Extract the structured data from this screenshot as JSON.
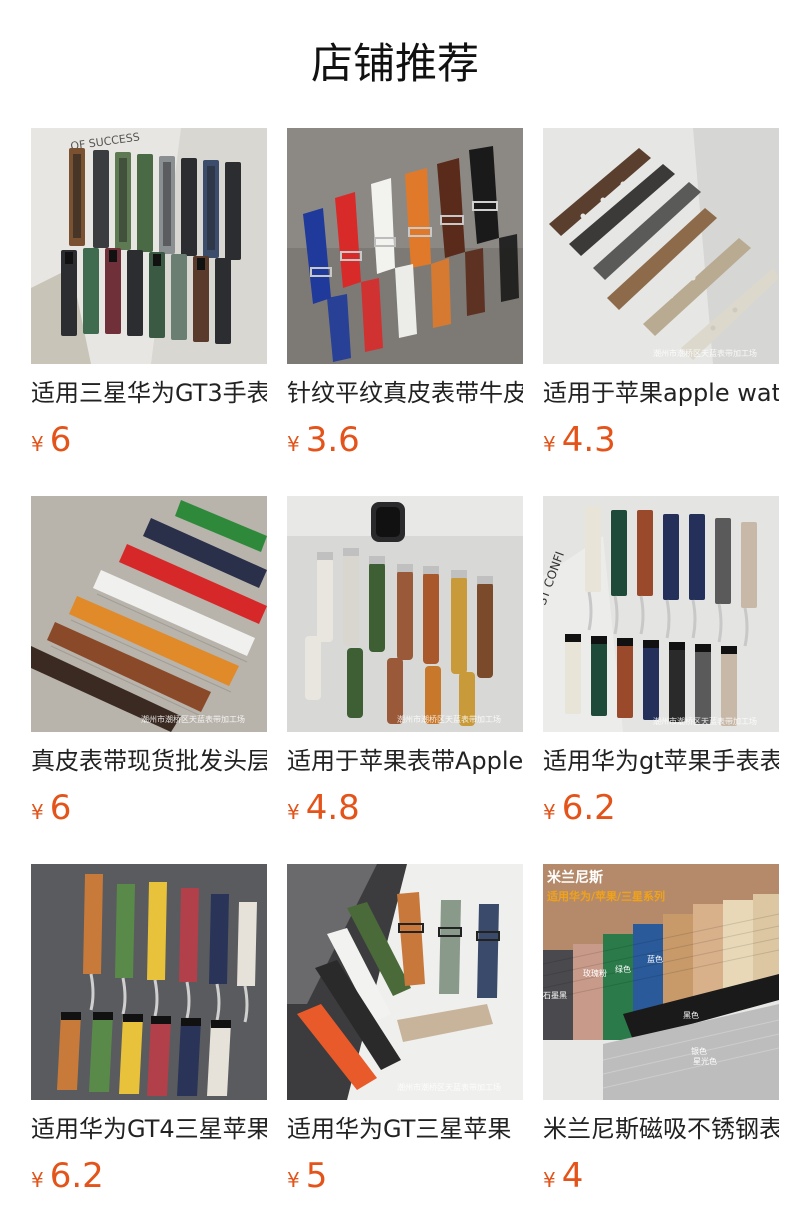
{
  "page": {
    "title": "店铺推荐",
    "currency_symbol": "¥"
  },
  "colors": {
    "price": "#e4531a",
    "title_text": "#222222"
  },
  "products": [
    {
      "title": "适用三星华为GT3手表",
      "price": "6",
      "image": {
        "scene": "bands-rubber-leather-grid",
        "background": "#d9d7d2",
        "accent_text": "OF SUCCESS",
        "strap_colors": [
          "#7a5232",
          "#3a3c3f",
          "#5d7a52",
          "#4a6a45",
          "#8a8f92",
          "#3b4d6b",
          "#2b2d30",
          "#6b2f2a",
          "#3f6b4e",
          "#70303a",
          "#5a3a2a",
          "#6a7e72"
        ]
      }
    },
    {
      "title": "针纹平纹真皮表带牛皮",
      "price": "3.6",
      "image": {
        "scene": "bands-leather-row",
        "background": "#7d7a76",
        "strap_colors": [
          "#1f3a9a",
          "#d92a2a",
          "#f2f2ef",
          "#e07a2a",
          "#5a2a1a",
          "#1a1a1a"
        ]
      }
    },
    {
      "title": "适用于苹果apple watch",
      "price": "4.3",
      "image": {
        "scene": "bands-loop-diagonal",
        "background": "#e6e6e4",
        "watermark": "潮州市潮桥区天蓝表带加工场",
        "strap_colors": [
          "#5a3e2e",
          "#3c3a38",
          "#5a5a58",
          "#8c6a4a",
          "#b8ab92",
          "#dcd8cc"
        ]
      }
    },
    {
      "title": "真皮表带现货批发头层",
      "price": "6",
      "image": {
        "scene": "bands-croc-diagonal",
        "background": "#b8b3ab",
        "watermark": "潮州市潮桥区天蓝表带加工场",
        "strap_colors": [
          "#2e8a3a",
          "#2a2f4a",
          "#d62828",
          "#f0f0ee",
          "#e08a2a",
          "#8a4a2a",
          "#3a2a22"
        ]
      }
    },
    {
      "title": "适用于苹果表带Apple",
      "price": "4.8",
      "image": {
        "scene": "bands-apple-leather",
        "background": "#d8d8d6",
        "watermark": "潮州市潮桥区天蓝表带加工场",
        "strap_colors": [
          "#e8e6df",
          "#d8d6cf",
          "#3e5e34",
          "#9a5a3a",
          "#c8782a",
          "#c89a3a",
          "#7a4a2a"
        ]
      }
    },
    {
      "title": "适用华为gt苹果手表表带",
      "price": "6.2",
      "image": {
        "scene": "bands-butterfly-clasp",
        "background": "#e4e4e2",
        "accent_text": "ST CONFI",
        "watermark": "潮州市潮桥区天蓝表带加工场",
        "strap_colors": [
          "#e8e4d8",
          "#1e4a3a",
          "#9a4a2a",
          "#24305a",
          "#5a5a5a",
          "#2a2a2a",
          "#c8b8a8"
        ]
      }
    },
    {
      "title": "适用华为GT4三星苹果",
      "price": "6.2",
      "image": {
        "scene": "bands-butterfly-colors",
        "background": "#5a5b5e",
        "strap_colors": [
          "#c87a3a",
          "#5a8a4a",
          "#e8c23a",
          "#b2404a",
          "#2a3458",
          "#e6e2da"
        ]
      }
    },
    {
      "title": "适用华为GT三星苹果",
      "price": "5",
      "image": {
        "scene": "bands-canvas-mix",
        "background": "#efefed",
        "watermark": "潮州市潮桥区天蓝表带加工场",
        "strap_colors": [
          "#f2f2f0",
          "#2a2a2a",
          "#e85a2a",
          "#4a6a3a",
          "#c8783a",
          "#8a9a8a",
          "#3a4a6a",
          "#c8b49a"
        ]
      }
    },
    {
      "title": "米兰尼斯磁吸不锈钢表带",
      "price": "4",
      "image": {
        "scene": "bands-milanese",
        "background": "#e8e8e6",
        "overlay_title": "米兰尼斯",
        "overlay_subtitle": "适用华为/苹果/三星系列",
        "mesh_labels": [
          "石墨黑",
          "玫瑰粉",
          "绿色",
          "蓝色",
          "黑色",
          "银色",
          "星光色"
        ],
        "strap_colors": [
          "#4a4a4e",
          "#c89a8a",
          "#2a7a4a",
          "#2a5a9a",
          "#c89a6a",
          "#d8b08a",
          "#e8d8b8",
          "#1a1a1a",
          "#bdbdbd"
        ]
      }
    }
  ]
}
